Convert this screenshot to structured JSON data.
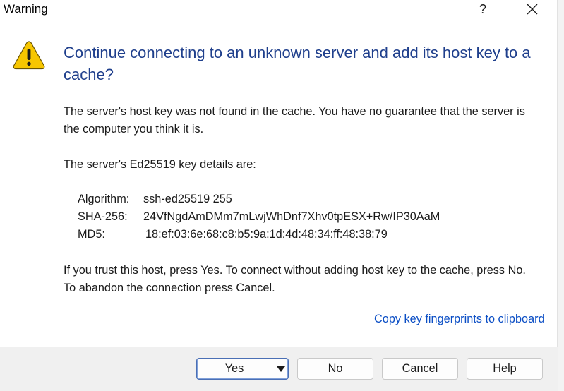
{
  "window": {
    "title": "Warning"
  },
  "titlebar": {
    "help_glyph": "?",
    "close_icon": "close-icon"
  },
  "icon": "warning-icon",
  "heading": "Continue connecting to an unknown server and add its host key to a cache?",
  "paragraph1": "The server's host key was not found in the cache. You have no guarantee that the server is the computer you think it is.",
  "paragraph2": "The server's Ed25519 key details are:",
  "key_details": [
    {
      "label": "Algorithm:",
      "value": "ssh-ed25519 255"
    },
    {
      "label": "SHA-256:",
      "value": "24VfNgdAmDMm7mLwjWhDnf7Xhv0tpESX+Rw/IP30AaM"
    },
    {
      "label": "MD5:",
      "value": "18:ef:03:6e:68:c8:b5:9a:1d:4d:48:34:ff:48:38:79"
    }
  ],
  "paragraph3": "If you trust this host, press Yes. To connect without adding host key to the cache, press No. To abandon the connection press Cancel.",
  "copy_link": "Copy key fingerprints to clipboard",
  "buttons": {
    "yes": "Yes",
    "no": "No",
    "cancel": "Cancel",
    "help": "Help"
  },
  "colors": {
    "heading": "#1f3f8c",
    "link": "#0b4ec5",
    "warning_fill": "#f7c600",
    "footer": "#f0f0f0"
  }
}
